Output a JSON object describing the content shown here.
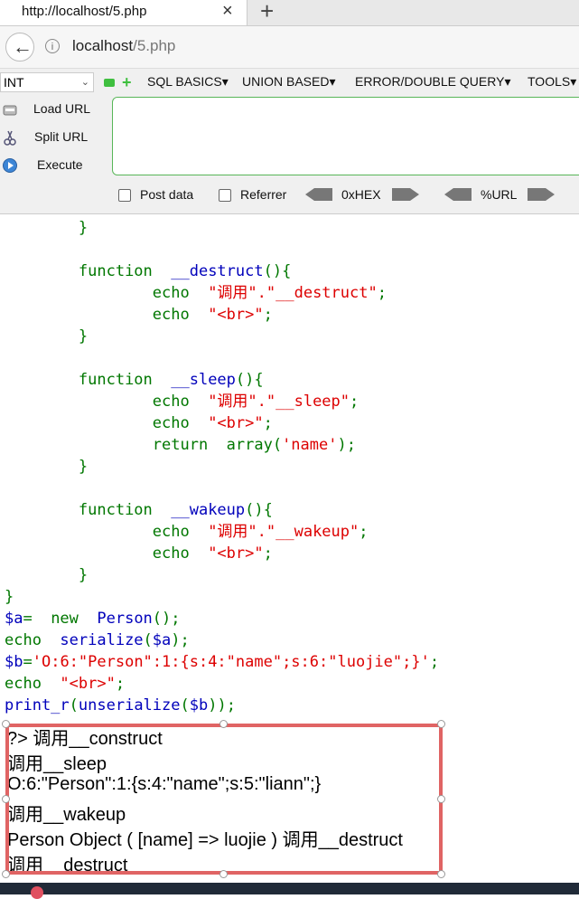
{
  "browser": {
    "tab_title": "http://localhost/5.php",
    "tab_close": "×",
    "new_tab": "+",
    "url_host": "localhost",
    "url_path": "/5.php"
  },
  "hackbar": {
    "select_value": "INT",
    "menu": [
      "SQL BASICS",
      "UNION BASED",
      "ERROR/DOUBLE QUERY",
      "TOOLS"
    ],
    "buttons": [
      "Load URL",
      "Split URL",
      "Execute"
    ],
    "url_value": "",
    "post_data_label": "Post data",
    "referrer_label": "Referrer",
    "hex_label": "0xHEX",
    "url_enc_label": "%URL",
    "colors": {
      "field_border": "#58b658",
      "icon_green": "#3fbf3f"
    }
  },
  "code_lines": [
    {
      "indent": "                ",
      "parts": [
        [
          "kw",
          "echo  "
        ],
        [
          "str",
          "\"<br>\""
        ],
        [
          "kw",
          ";"
        ]
      ]
    },
    {
      "indent": "        ",
      "parts": [
        [
          "kw",
          "}"
        ]
      ]
    },
    {
      "indent": "",
      "parts": []
    },
    {
      "indent": "        ",
      "parts": [
        [
          "kw",
          "function  "
        ],
        [
          "var",
          "__destruct"
        ],
        [
          "kw",
          "(){"
        ]
      ]
    },
    {
      "indent": "                ",
      "parts": [
        [
          "kw",
          "echo  "
        ],
        [
          "str",
          "\"调用\".\"__destruct\""
        ],
        [
          "kw",
          ";"
        ]
      ]
    },
    {
      "indent": "                ",
      "parts": [
        [
          "kw",
          "echo  "
        ],
        [
          "str",
          "\"<br>\""
        ],
        [
          "kw",
          ";"
        ]
      ]
    },
    {
      "indent": "        ",
      "parts": [
        [
          "kw",
          "}"
        ]
      ]
    },
    {
      "indent": "",
      "parts": []
    },
    {
      "indent": "        ",
      "parts": [
        [
          "kw",
          "function  "
        ],
        [
          "var",
          "__sleep"
        ],
        [
          "kw",
          "(){"
        ]
      ]
    },
    {
      "indent": "                ",
      "parts": [
        [
          "kw",
          "echo  "
        ],
        [
          "str",
          "\"调用\".\"__sleep\""
        ],
        [
          "kw",
          ";"
        ]
      ]
    },
    {
      "indent": "                ",
      "parts": [
        [
          "kw",
          "echo  "
        ],
        [
          "str",
          "\"<br>\""
        ],
        [
          "kw",
          ";"
        ]
      ]
    },
    {
      "indent": "                ",
      "parts": [
        [
          "kw",
          "return  array("
        ],
        [
          "str",
          "'name'"
        ],
        [
          "kw",
          ");"
        ]
      ]
    },
    {
      "indent": "        ",
      "parts": [
        [
          "kw",
          "}"
        ]
      ]
    },
    {
      "indent": "",
      "parts": []
    },
    {
      "indent": "        ",
      "parts": [
        [
          "kw",
          "function  "
        ],
        [
          "var",
          "__wakeup"
        ],
        [
          "kw",
          "(){"
        ]
      ]
    },
    {
      "indent": "                ",
      "parts": [
        [
          "kw",
          "echo  "
        ],
        [
          "str",
          "\"调用\".\"__wakeup\""
        ],
        [
          "kw",
          ";"
        ]
      ]
    },
    {
      "indent": "                ",
      "parts": [
        [
          "kw",
          "echo  "
        ],
        [
          "str",
          "\"<br>\""
        ],
        [
          "kw",
          ";"
        ]
      ]
    },
    {
      "indent": "        ",
      "parts": [
        [
          "kw",
          "}"
        ]
      ]
    },
    {
      "indent": "",
      "parts": [
        [
          "kw",
          "}"
        ]
      ]
    },
    {
      "indent": "",
      "parts": [
        [
          "var",
          "$a"
        ],
        [
          "kw",
          "=  new  "
        ],
        [
          "var",
          "Person"
        ],
        [
          "kw",
          "();"
        ]
      ]
    },
    {
      "indent": "",
      "parts": [
        [
          "kw",
          "echo  "
        ],
        [
          "var",
          "serialize"
        ],
        [
          "kw",
          "("
        ],
        [
          "var",
          "$a"
        ],
        [
          "kw",
          ");"
        ]
      ]
    },
    {
      "indent": "",
      "parts": [
        [
          "var",
          "$b"
        ],
        [
          "kw",
          "="
        ],
        [
          "str",
          "'O:6:\"Person\":1:{s:4:\"name\";s:6:\"luojie\";}'"
        ],
        [
          "kw",
          ";"
        ]
      ]
    },
    {
      "indent": "",
      "parts": [
        [
          "kw",
          "echo  "
        ],
        [
          "str",
          "\"<br>\""
        ],
        [
          "kw",
          ";"
        ]
      ]
    },
    {
      "indent": "",
      "parts": [
        [
          "var",
          "print_r"
        ],
        [
          "kw",
          "("
        ],
        [
          "var",
          "unserialize"
        ],
        [
          "kw",
          "("
        ],
        [
          "var",
          "$b"
        ],
        [
          "kw",
          "));"
        ]
      ]
    }
  ],
  "output_lines": [
    "?> 调用__construct",
    "调用__sleep",
    "O:6:\"Person\":1:{s:4:\"name\";s:5:\"liann\";}",
    "调用__wakeup",
    "Person Object ( [name] => luojie ) 调用__destruct",
    "调用__destruct"
  ]
}
